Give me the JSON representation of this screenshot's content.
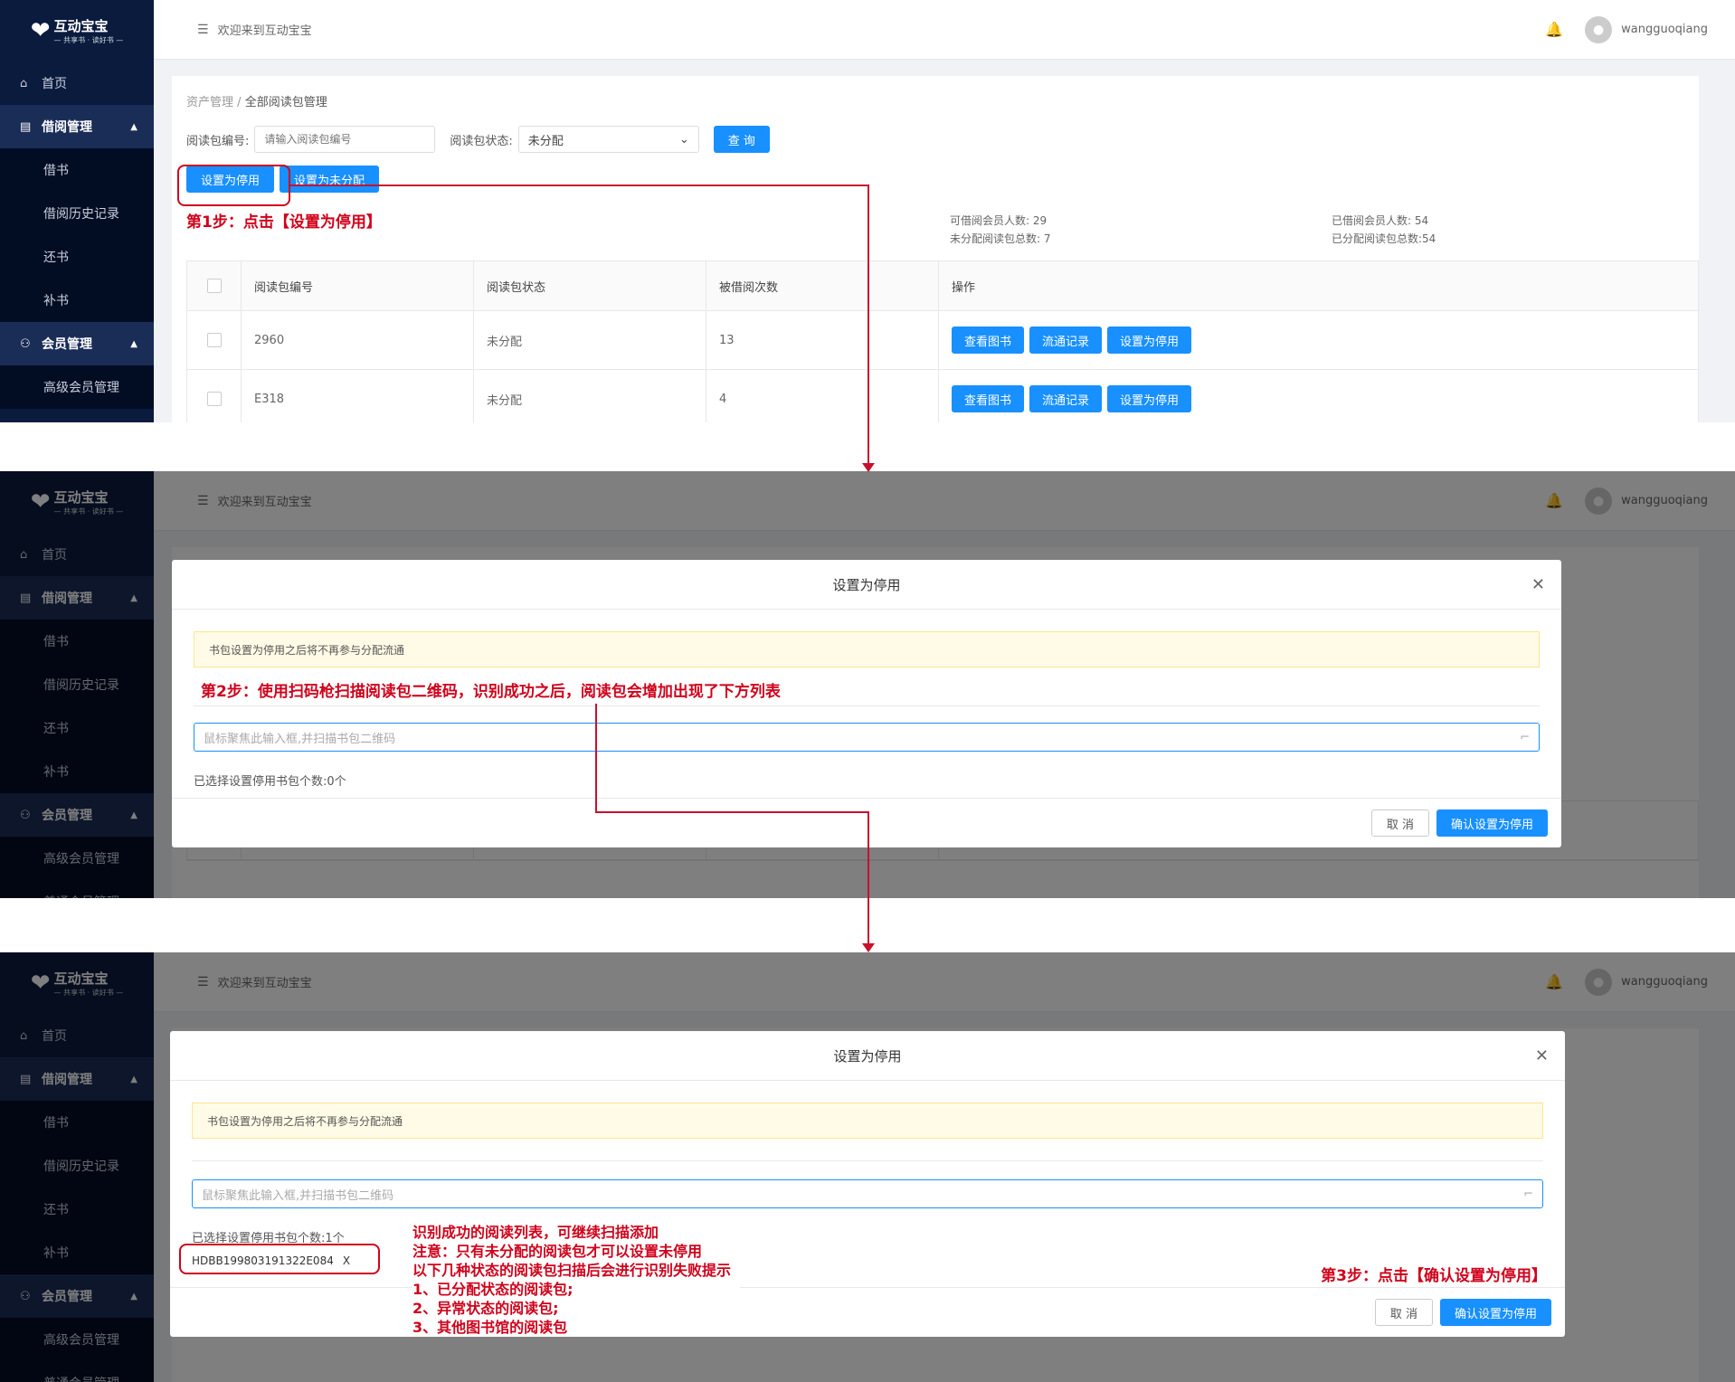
{
  "app": {
    "logo": "互动宝宝",
    "logo_sub": "— 共享书 · 读好书 —",
    "welcome": "欢迎来到互动宝宝",
    "user": "wangguoqiang"
  },
  "sidebar": {
    "items": [
      {
        "label": "首页",
        "type": "top"
      },
      {
        "label": "借阅管理",
        "type": "group"
      },
      {
        "label": "借书",
        "type": "sub"
      },
      {
        "label": "借阅历史记录",
        "type": "sub"
      },
      {
        "label": "还书",
        "type": "sub"
      },
      {
        "label": "补书",
        "type": "sub"
      },
      {
        "label": "会员管理",
        "type": "group"
      },
      {
        "label": "高级会员管理",
        "type": "sub"
      },
      {
        "label": "普通会员管理",
        "type": "sub"
      }
    ]
  },
  "breadcrumb": {
    "parent": "资产管理",
    "sep": "/",
    "current": "全部阅读包管理"
  },
  "filter": {
    "code_label": "阅读包编号:",
    "code_placeholder": "请输入阅读包编号",
    "status_label": "阅读包状态:",
    "status_value": "未分配",
    "search_btn": "查 询"
  },
  "actions": {
    "set_disabled": "设置为停用",
    "set_unassigned": "设置为未分配"
  },
  "stats": {
    "borrowable": "可借阅会员人数: 29",
    "unassigned_total": "未分配阅读包总数: 7",
    "borrowed": "已借阅会员人数: 54",
    "assigned_total": "已分配阅读包总数:54"
  },
  "table": {
    "headers": [
      "阅读包编号",
      "阅读包状态",
      "被借阅次数",
      "操作"
    ],
    "rows": [
      {
        "code": "2960",
        "status": "未分配",
        "count": "13"
      },
      {
        "code": "E318",
        "status": "未分配",
        "count": "4"
      }
    ],
    "row_actions": [
      "查看图书",
      "流通记录",
      "设置为停用"
    ]
  },
  "modal": {
    "title": "设置为停用",
    "warning": "书包设置为停用之后将不再参与分配流通",
    "scan_placeholder": "鼠标聚焦此输入框,并扫描书包二维码",
    "count_empty": "已选择设置停用书包个数:0个",
    "count_one": "已选择设置停用书包个数:1个",
    "tag": "HDBB199803191322E084",
    "tag_close": "X",
    "cancel": "取 消",
    "confirm": "确认设置为停用"
  },
  "annotations": {
    "step1": "第1步：点击【设置为停用】",
    "step2": "第2步：使用扫码枪扫描阅读包二维码，识别成功之后，阅读包会增加出现了下方列表",
    "step3": "第3步：点击【确认设置为停用】",
    "note": [
      "识别成功的阅读列表，可继续扫描添加",
      "注意：只有未分配的阅读包才可以设置未停用",
      "以下几种状态的阅读包扫描后会进行识别失败提示",
      "1、已分配状态的阅读包;",
      "2、异常状态的阅读包;",
      "3、其他图书馆的阅读包"
    ]
  },
  "colors": {
    "primary": "#1890ff",
    "sidebar": "#0b1b3e",
    "annotation": "#d0021b"
  }
}
